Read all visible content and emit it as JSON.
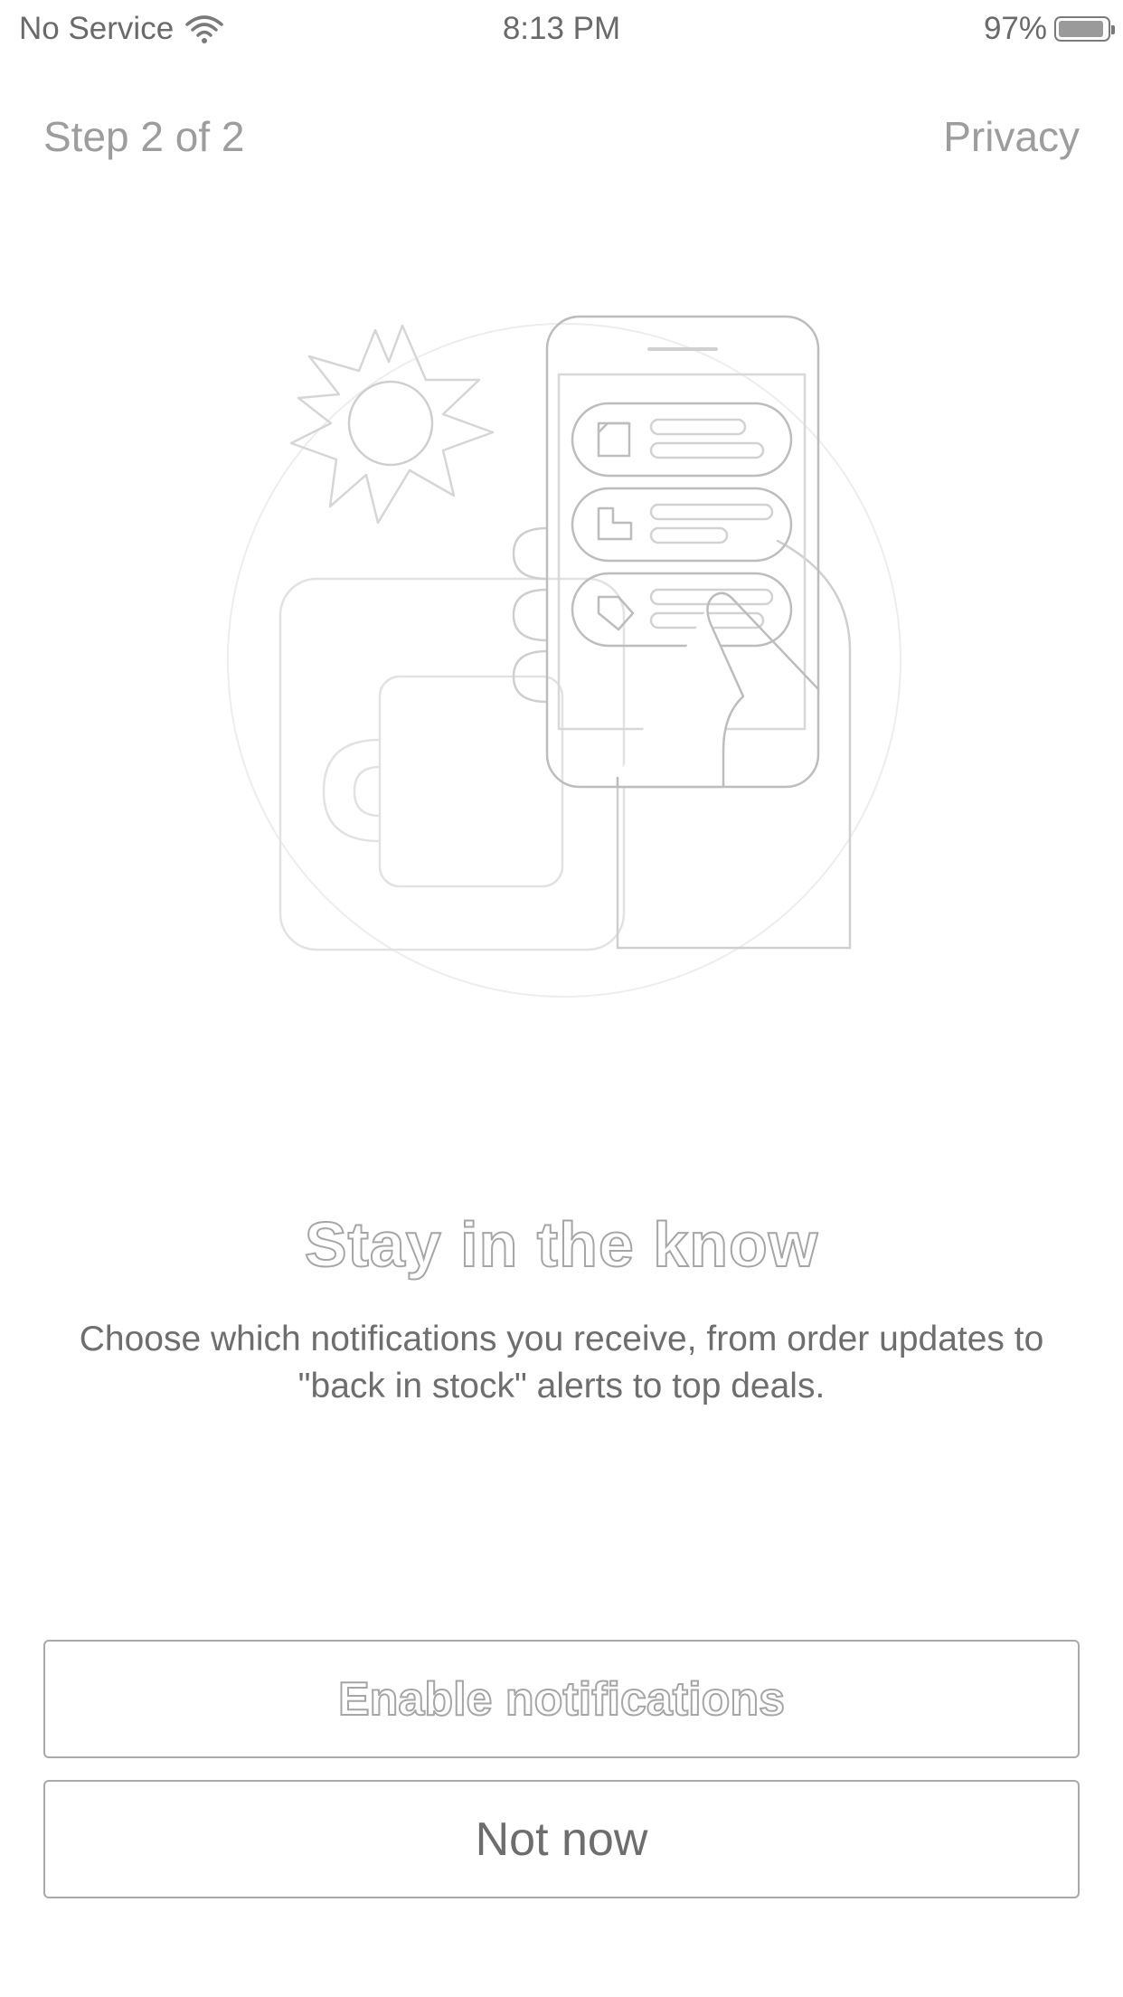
{
  "status_bar": {
    "carrier": "No Service",
    "time": "8:13 PM",
    "battery_percent": "97%",
    "battery_level": 0.97,
    "icons": [
      "wifi-icon",
      "battery-icon"
    ]
  },
  "header": {
    "step": "Step 2 of 2",
    "privacy": "Privacy"
  },
  "illustration": {
    "icon": "notification-phone-illustration"
  },
  "content": {
    "headline": "Stay in the know",
    "description": "Choose which notifications you receive, from order updates to \"back in stock\" alerts to top deals."
  },
  "buttons": {
    "enable": "Enable notifications",
    "not_now": "Not now"
  },
  "colors": {
    "background": "#ffffff",
    "text": "#6e6e6e",
    "muted_text": "#9d9d9d",
    "border": "#a9a9a9"
  }
}
